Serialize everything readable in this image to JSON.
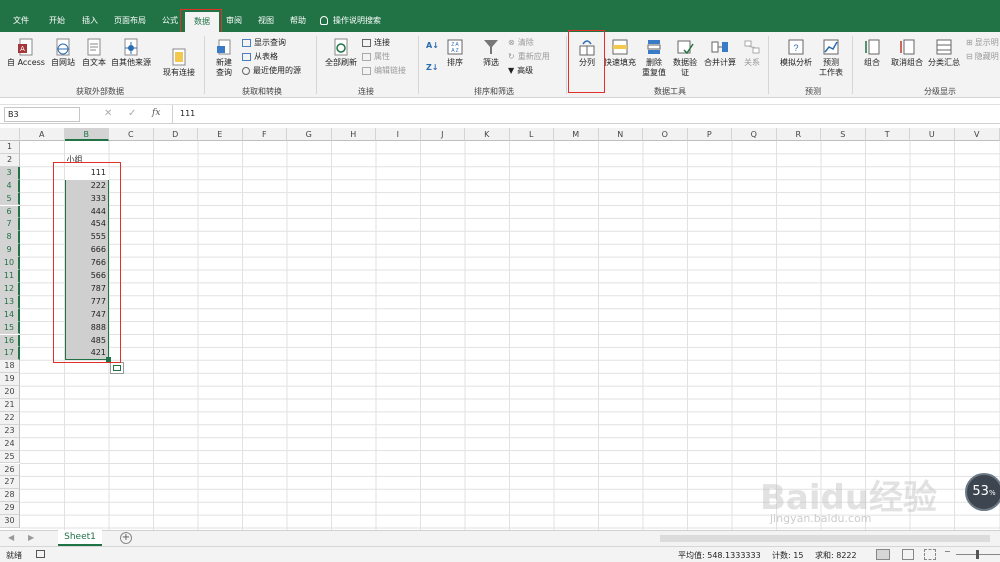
{
  "ribbon_tabs": [
    "文件",
    "开始",
    "插入",
    "页面布局",
    "公式",
    "数据",
    "审阅",
    "视图",
    "帮助"
  ],
  "active_tab": "数据",
  "tell_me": "操作说明搜索",
  "ext_data": {
    "access": "自 Access",
    "web": "自网站",
    "text": "自文本",
    "other": "自其他来源",
    "existing": "现有连接",
    "label": "获取外部数据"
  },
  "get_transform": {
    "new_query_1": "新建",
    "new_query_2": "查询",
    "show_queries": "显示查询",
    "from_table": "从表格",
    "recent_sources": "最近使用的源",
    "label": "获取和转换"
  },
  "connections": {
    "refresh_all": "全部刷新",
    "connections": "连接",
    "properties": "属性",
    "edit_links": "编辑链接",
    "label": "连接"
  },
  "sort_filter": {
    "sort": "排序",
    "filter": "筛选",
    "clear": "清除",
    "reapply": "重新应用",
    "advanced": "高级",
    "label": "排序和筛选"
  },
  "data_tools": {
    "split": "分列",
    "flash_fill": "快速填充",
    "remove_dup_1": "删除",
    "remove_dup_2": "重复值",
    "validation_1": "数据验",
    "validation_2": "证",
    "consolidate": "合并计算",
    "relationships": "关系",
    "label": "数据工具"
  },
  "forecast": {
    "what_if": "模拟分析",
    "sheet_1": "预测",
    "sheet_2": "工作表",
    "label": "预测"
  },
  "outline": {
    "group": "组合",
    "ungroup": "取消组合",
    "subtotal": "分类汇总",
    "show_detail": "显示明",
    "hide_detail": "隐藏明",
    "label": "分级显示"
  },
  "formula_bar": {
    "name_box": "B3",
    "fx": "fx",
    "value": "111"
  },
  "columns": [
    "A",
    "B",
    "C",
    "D",
    "E",
    "F",
    "G",
    "H",
    "I",
    "J",
    "K",
    "L",
    "M",
    "N",
    "O",
    "P",
    "Q",
    "R",
    "S",
    "T",
    "U",
    "V"
  ],
  "rows": [
    "1",
    "2",
    "3",
    "4",
    "5",
    "6",
    "7",
    "8",
    "9",
    "10",
    "11",
    "12",
    "13",
    "14",
    "15",
    "16",
    "17",
    "18",
    "19",
    "20",
    "21",
    "22",
    "23",
    "24",
    "25",
    "26",
    "27",
    "28",
    "29",
    "30"
  ],
  "cells": {
    "B2": "小组",
    "B_values": [
      "111",
      "222",
      "333",
      "444",
      "454",
      "555",
      "666",
      "766",
      "566",
      "787",
      "777",
      "747",
      "888",
      "485",
      "421"
    ]
  },
  "sheet_tab": "Sheet1",
  "status": {
    "ready": "就绪",
    "average": "平均值: 548.1333333",
    "count": "计数: 15",
    "sum": "求和: 8222"
  },
  "watermark": {
    "brand": "Baidu经验",
    "url": "jingyan.baidu.com"
  },
  "progress_badge": "53",
  "progress_unit": "%",
  "colors": {
    "excel_green": "#217346",
    "highlight_red": "#e0302a",
    "selection_gray": "#cfcfcf"
  }
}
